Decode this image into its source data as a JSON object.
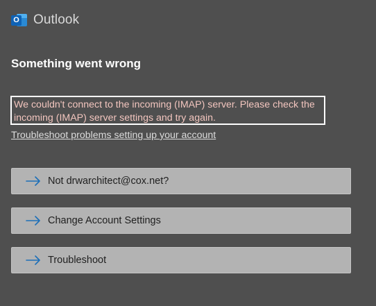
{
  "app": {
    "name": "Outlook",
    "logo_letter": "O"
  },
  "error": {
    "title": "Something went wrong",
    "message_line1": "We couldn't connect to the incoming (IMAP) server. Please check the",
    "message_line2": "incoming (IMAP) server settings and try again.",
    "help_link": "Troubleshoot problems setting up your account"
  },
  "actions": [
    {
      "label": "Not drwarchitect@cox.net?",
      "icon": "arrow-right-icon"
    },
    {
      "label": "Change Account Settings",
      "icon": "arrow-right-icon"
    },
    {
      "label": "Troubleshoot",
      "icon": "arrow-right-icon"
    }
  ],
  "colors": {
    "background": "#4f4f4f",
    "button": "#b3b3b3",
    "arrow": "#1d6fb8",
    "error_text": "#f3c6bf",
    "logo_blue": "#0f62b5"
  }
}
